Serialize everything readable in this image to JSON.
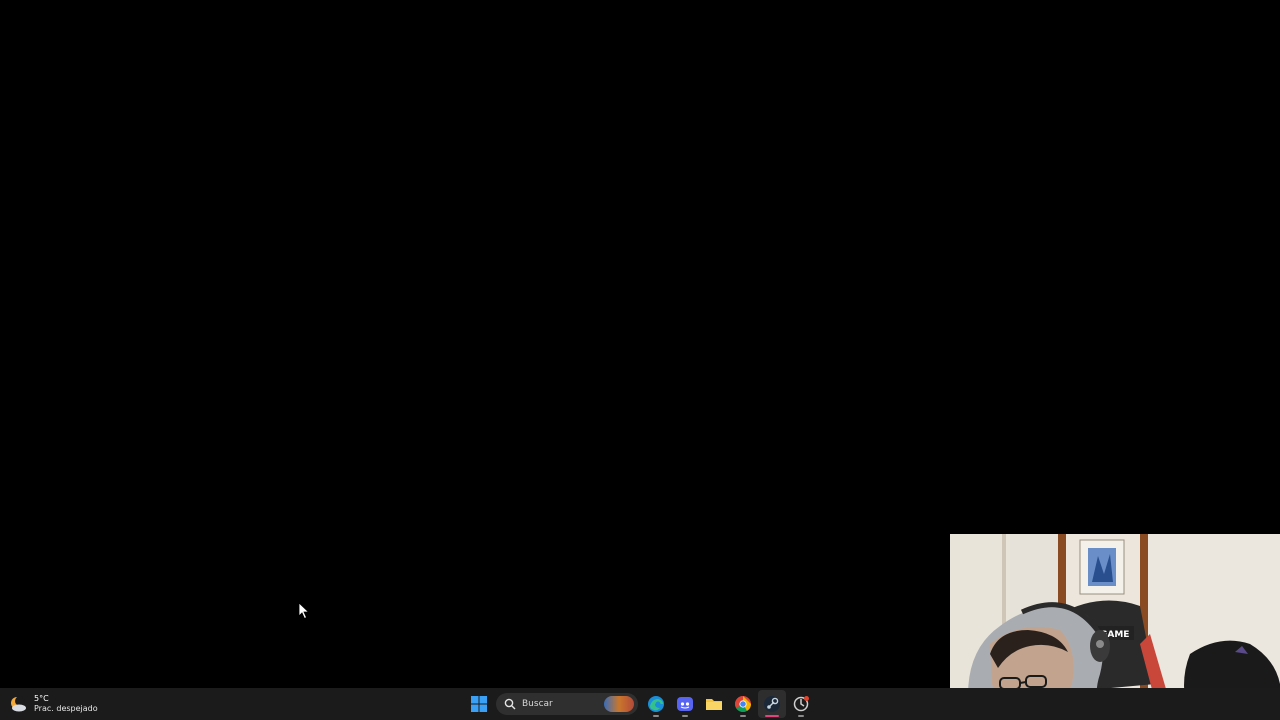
{
  "taskbar": {
    "weather": {
      "temperature": "5°C",
      "condition": "Prac. despejado",
      "icon": "partly-cloudy-night-icon"
    },
    "search": {
      "placeholder": "Buscar",
      "icon": "search-icon"
    },
    "apps": [
      {
        "name": "start",
        "icon": "windows-logo-icon"
      },
      {
        "name": "edge",
        "icon": "edge-icon"
      },
      {
        "name": "discord",
        "icon": "discord-icon"
      },
      {
        "name": "file-explorer",
        "icon": "folder-icon"
      },
      {
        "name": "chrome",
        "icon": "chrome-icon"
      },
      {
        "name": "steam",
        "icon": "steam-icon",
        "active": true
      },
      {
        "name": "app",
        "icon": "app-icon"
      }
    ],
    "colors": {
      "background": "#1b1b1b",
      "active_indicator": "#e0447a"
    }
  },
  "desktop": {
    "background": "#000000"
  },
  "webcam": {
    "label": "webcam-overlay"
  }
}
